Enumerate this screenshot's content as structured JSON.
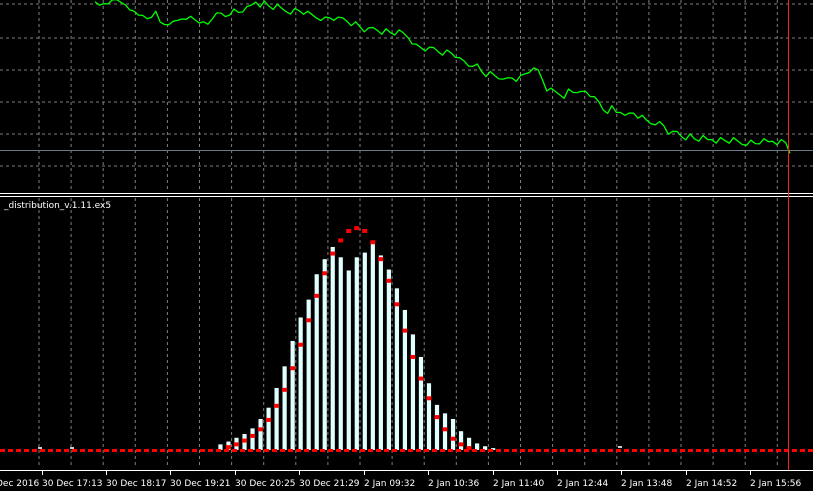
{
  "window": {
    "indicator_label": "_distribution_v.1.11.ex5",
    "background": "#000000",
    "grid_color": "#7f7f7f",
    "price_line_color": "#00ff00",
    "bar_color": "#e0ffff",
    "marker_color": "#ff0000",
    "cursor_line_color": "#ff2020",
    "separator_color": "#ffffff"
  },
  "time_axis": {
    "labels": [
      "Dec 2016",
      "30 Dec 17:13",
      "30 Dec 18:17",
      "30 Dec 19:21",
      "30 Dec 20:25",
      "30 Dec 21:29",
      "2 Jan 09:32",
      "2 Jan 10:36",
      "2 Jan 11:40",
      "2 Jan 12:44",
      "2 Jan 13:48",
      "2 Jan 14:52",
      "2 Jan 15:56"
    ]
  },
  "chart_data": [
    {
      "type": "line",
      "description_role": "main price pane",
      "series": [
        {
          "values": [
            0.2,
            0.25,
            0.15,
            0.1,
            0.12,
            0.05,
            0.08,
            0.3,
            0.4,
            0.38,
            0.45,
            0.6,
            0.65,
            0.55,
            0.5,
            0.78,
            0.8,
            0.75,
            0.78,
            0.7,
            0.6,
            0.75,
            0.6,
            0.65,
            0.7,
            0.8,
            0.82,
            0.6,
            0.55,
            0.5,
            0.55,
            0.45,
            0.4,
            0.45,
            0.38,
            0.35,
            0.25,
            0.1,
            0.2,
            0.15,
            0.25,
            0.3,
            0.28,
            0.35,
            0.4,
            0.42,
            0.38,
            0.4,
            0.45,
            0.5,
            0.55,
            0.6,
            0.62,
            0.65,
            0.62,
            0.64,
            0.68,
            0.65,
            0.7,
            0.78,
            0.8,
            0.9,
            1.0,
            1.02,
            0.95,
            0.98,
            1.05,
            1.02,
            1.08,
            1.1,
            1.08,
            1.12,
            1.2,
            1.35,
            1.5,
            1.55,
            1.6,
            1.62,
            1.58,
            1.65,
            1.7,
            1.68,
            1.72,
            1.8,
            1.95,
            2.0,
            2.1,
            2.05,
            2.12,
            2.3,
            2.4,
            2.38,
            2.45,
            2.5,
            2.45,
            2.55,
            2.5,
            2.55,
            2.5,
            2.4,
            2.3,
            2.1,
            2.3,
            2.55,
            2.85,
            2.9,
            2.95,
            3.0,
            3.05,
            2.9,
            2.95,
            2.9,
            3.0,
            2.95,
            3.05,
            3.0,
            3.3,
            3.5,
            3.55,
            3.45,
            3.6,
            3.55,
            3.58,
            3.65,
            3.6,
            3.7,
            3.75,
            3.85,
            3.9,
            3.88,
            3.92,
            4.0,
            4.2,
            4.25,
            4.2,
            4.3,
            4.35,
            4.3,
            4.4,
            4.42,
            4.38,
            4.45,
            4.4,
            4.45,
            4.42,
            4.45,
            4.48,
            4.45,
            4.5,
            4.55,
            4.52,
            4.5,
            4.55,
            4.5,
            4.48,
            4.52,
            4.45,
            4.5,
            4.48,
            4.52,
            4.8
          ]
        }
      ]
    },
    {
      "type": "bar",
      "description_role": "distribution indicator",
      "values": [
        0,
        0,
        0,
        0,
        0,
        0,
        0,
        0,
        0,
        0,
        0,
        0,
        0,
        0,
        0,
        0,
        0,
        0,
        0.6,
        0.9,
        1.3,
        1.7,
        2.3,
        3.3,
        4.5,
        6.6,
        8.9,
        11.6,
        14.1,
        16.0,
        18.7,
        20.3,
        21.6,
        20.5,
        19.1,
        20.5,
        21.0,
        22.0,
        20.7,
        19.2,
        17.2,
        14.9,
        12.3,
        9.9,
        7.1,
        4.8,
        3.9,
        3.3,
        2.0,
        1.3,
        0.7,
        0.4,
        0.2
      ],
      "markers": [
        0,
        0,
        0,
        0,
        0,
        0,
        0,
        0,
        0,
        0,
        0,
        0,
        0,
        0,
        0,
        0,
        0,
        0,
        0,
        0.3,
        0.6,
        1.0,
        1.5,
        2.2,
        3.2,
        4.7,
        6.4,
        8.7,
        11.2,
        13.8,
        16.4,
        18.8,
        20.9,
        22.3,
        23.3,
        23.6,
        23.3,
        22.1,
        20.3,
        18.0,
        15.5,
        12.7,
        9.9,
        7.6,
        5.5,
        3.5,
        2.2,
        1.2,
        0.6,
        0.2,
        0,
        0,
        0
      ],
      "ylim": [
        0,
        25
      ]
    }
  ]
}
